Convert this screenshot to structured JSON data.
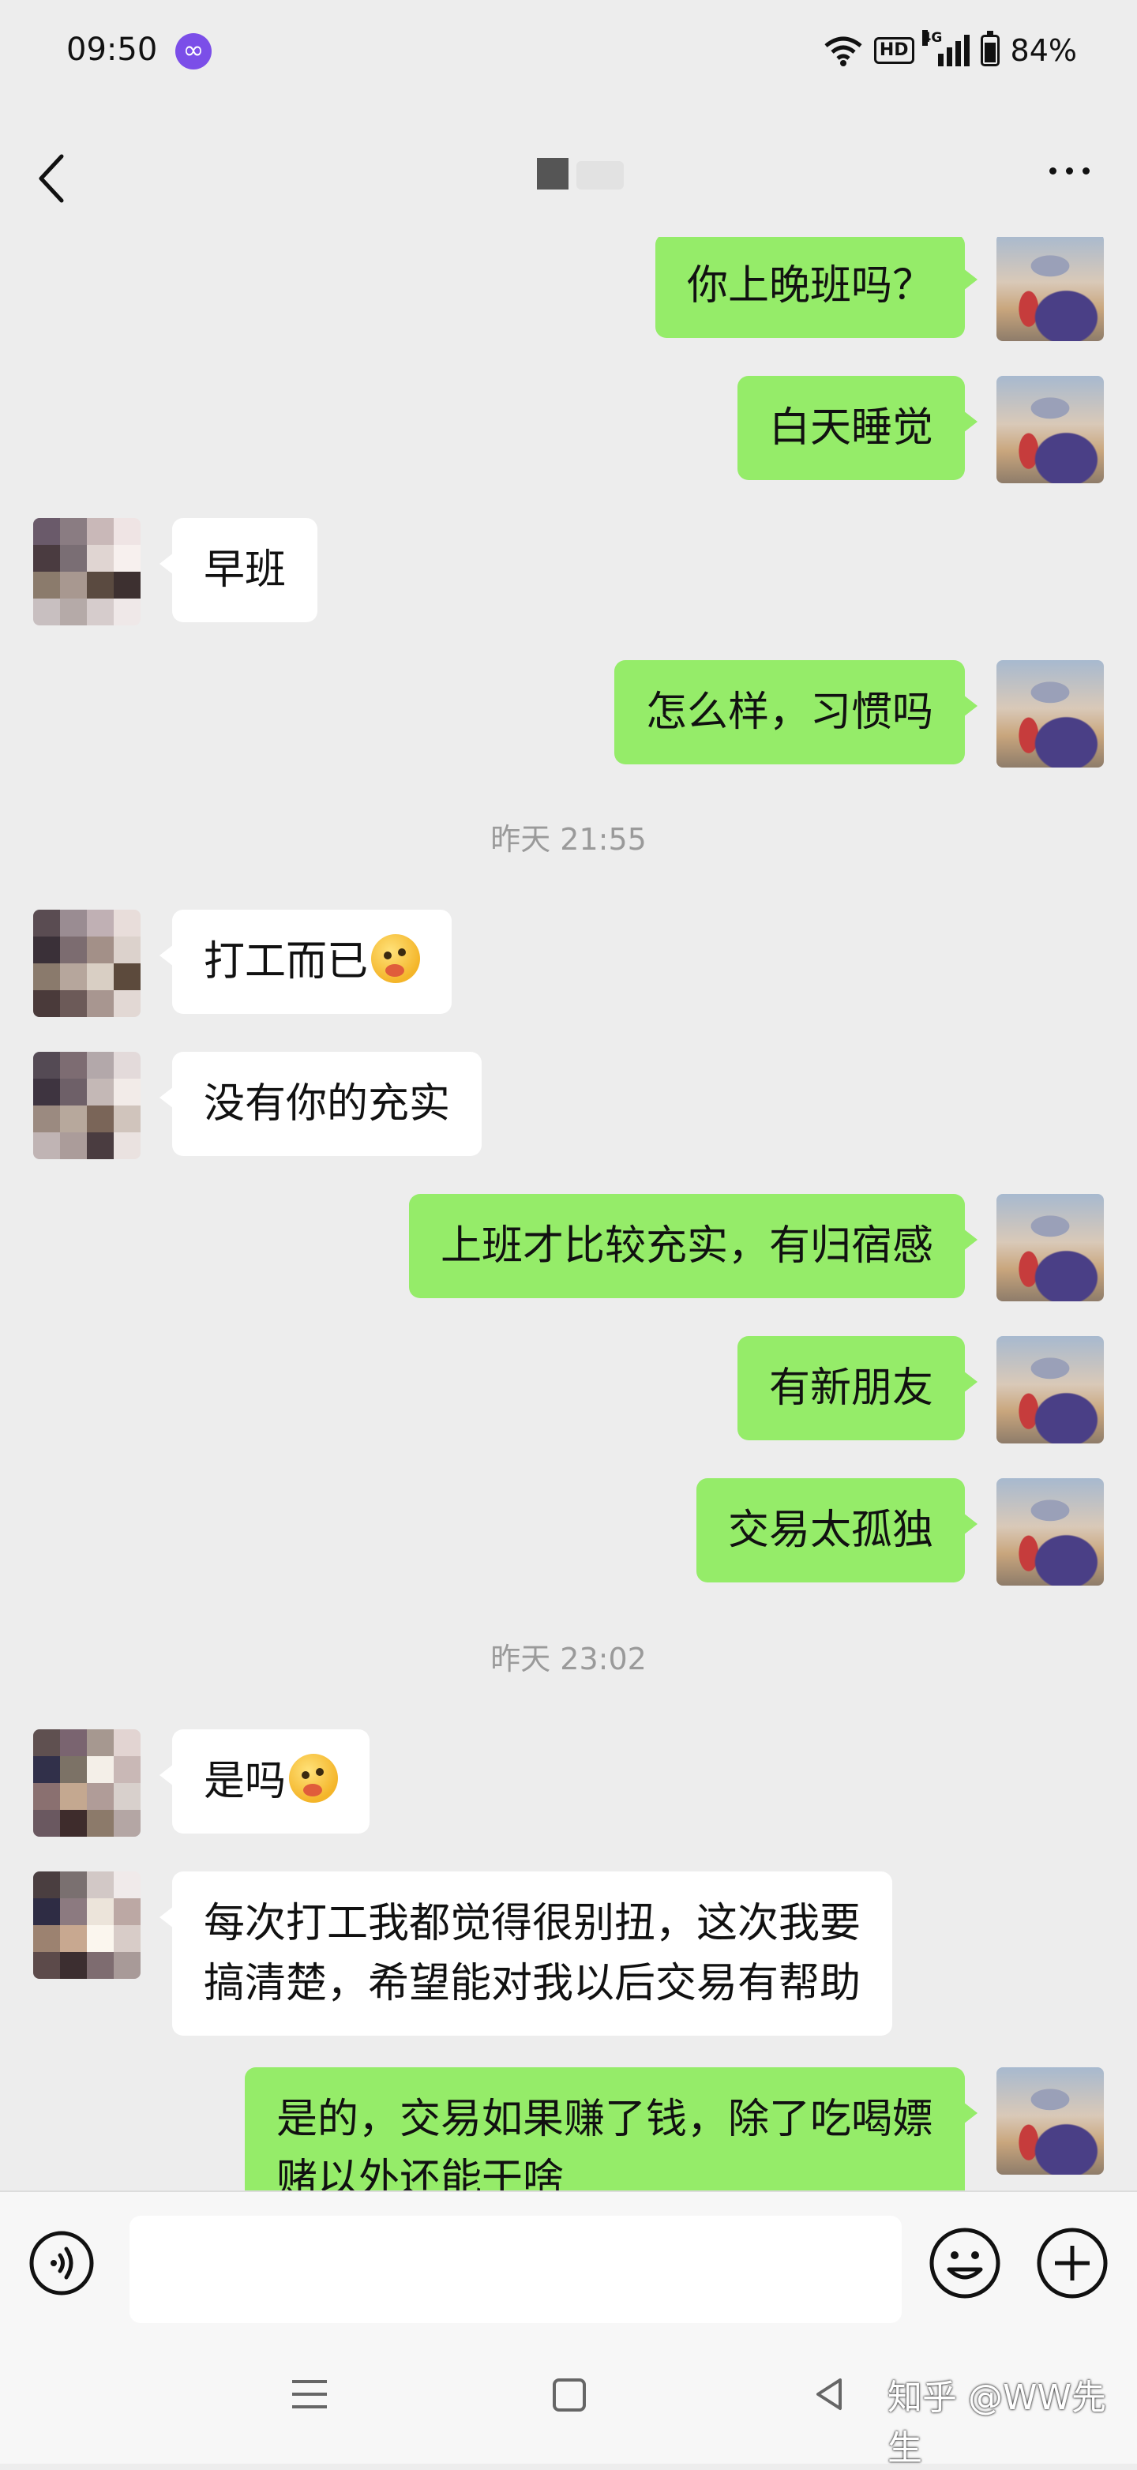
{
  "status_bar": {
    "time": "09:50",
    "hd": "HD",
    "network": "4G",
    "battery": "84%",
    "battery_level": 0.84
  },
  "header": {
    "back": "back-icon",
    "more": "more-icon"
  },
  "messages": [
    {
      "side": "right",
      "text": "你上晚班吗？",
      "top": 0
    },
    {
      "side": "right",
      "text": "白天睡觉"
    },
    {
      "side": "left",
      "text": "早班"
    },
    {
      "side": "right",
      "text": "怎么样，习惯吗"
    },
    {
      "side": "left",
      "text": "打工而已",
      "emoji": "emoji-face"
    },
    {
      "side": "left",
      "text": "没有你的充实"
    },
    {
      "side": "right",
      "text": "上班才比较充实，有归宿感"
    },
    {
      "side": "right",
      "text": "有新朋友"
    },
    {
      "side": "right",
      "text": "交易太孤独"
    },
    {
      "side": "left",
      "text": "是吗",
      "emoji": "emoji-face"
    },
    {
      "side": "left",
      "lines": [
        "每次打工我都觉得很别扭，这次我要",
        "搞清楚，希望能对我以后交易有帮助"
      ]
    },
    {
      "side": "right",
      "lines": [
        "是的，交易如果赚了钱，除了吃喝嫖",
        "赌以外还能干啥"
      ]
    }
  ],
  "timestamps": [
    "昨天 21:55",
    "昨天 23:02"
  ],
  "input_bar": {
    "placeholder": ""
  },
  "watermark": "知乎 @WW先生"
}
